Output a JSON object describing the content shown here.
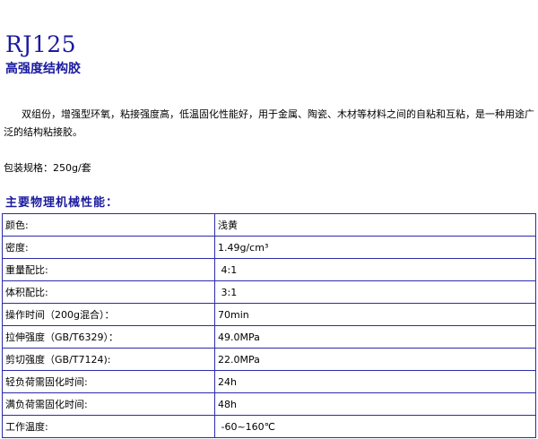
{
  "product": {
    "code": "RJ125",
    "name": "高强度结构胶"
  },
  "intro": "双组份，增强型环氧，粘接强度高，低温固化性能好，用于金属、陶瓷、木材等材料之间的自粘和互粘，是一种用途广泛的结构粘接胶。",
  "packaging": "包装规格：250g/套",
  "properties": {
    "heading": "主要物理机械性能：",
    "rows": [
      {
        "label": "颜色:",
        "value": "浅黄"
      },
      {
        "label": "密度:",
        "value": "1.49g/cm³"
      },
      {
        "label": "重量配比:",
        "value": " 4:1"
      },
      {
        "label": "体积配比:",
        "value": " 3:1"
      },
      {
        "label": "操作时间（200g混合）：",
        "value": "70min"
      },
      {
        "label": "拉伸强度（GB/T6329）：",
        "value": "49.0MPa"
      },
      {
        "label": "剪切强度（GB/T7124):",
        "value": "22.0MPa"
      },
      {
        "label": "轻负荷需固化时间:",
        "value": "24h"
      },
      {
        "label": "满负荷需固化时间:",
        "value": "48h"
      },
      {
        "label": "工作温度:",
        "value": " -60~160℃"
      }
    ]
  }
}
